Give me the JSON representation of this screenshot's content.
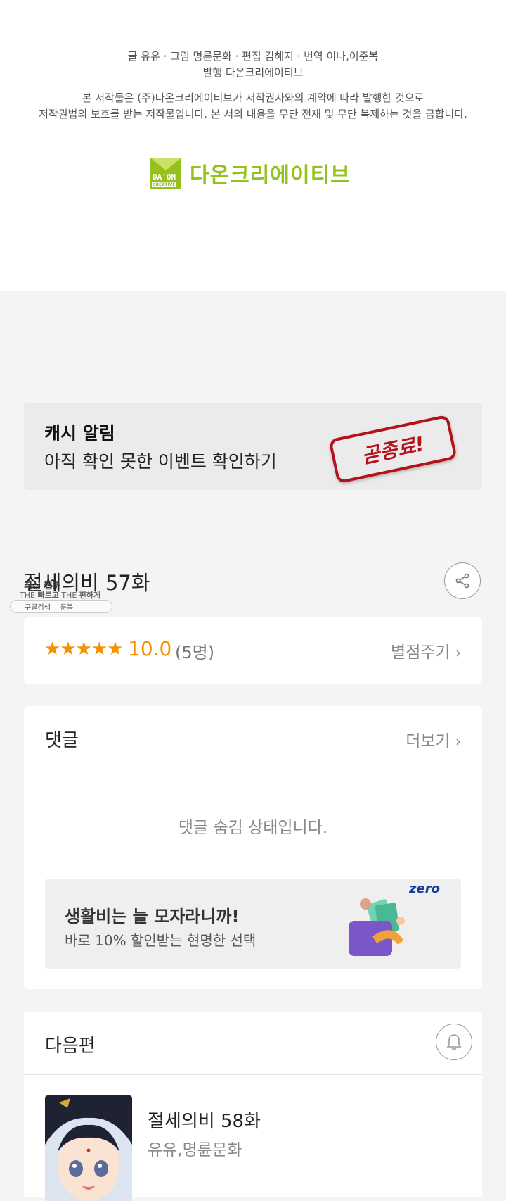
{
  "credits": {
    "line1": "글 유유 · 그림 명륜문화 · 편집 김혜지 · 번역 이나,이준복",
    "line2": "발행 다온크리에이티브",
    "line3": "본 저작물은 (주)다온크리에이티브가 저작권자와의 계약에 따라 발행한 것으로",
    "line4": "저작권법의 보호를 받는 저작물입니다. 본 서의 내용을 무단 전재 및 무단 복제하는 것을 금합니다.",
    "logo_mark_top": "DA'ON",
    "logo_mark_bottom": "CREATIVE",
    "logo_text": "다온크리에이티브"
  },
  "banner": {
    "title": "캐시 알림",
    "subtitle": "아직 확인 못한 이벤트 확인하기",
    "stamp": "곧종료!"
  },
  "episode": {
    "title": "절세의비 57화"
  },
  "watermark": {
    "line1": "최신 웹툰",
    "line2_a": "THE",
    "line2_b": "빠르고",
    "line2_c": "THE",
    "line2_d": "편하게",
    "search_label": "구글검색",
    "site_label": "툰북"
  },
  "rating": {
    "stars": "★★★★★",
    "score": "10.0",
    "count": "(5명)",
    "action": "별점주기"
  },
  "comments": {
    "heading": "댓글",
    "more": "더보기",
    "hidden_message": "댓글 숨김 상태입니다."
  },
  "ad": {
    "title": "생활비는 늘 모자라니까!",
    "subtitle": "바로 10% 할인받는 현명한 선택",
    "brand": "zero"
  },
  "next": {
    "heading": "다음편",
    "title": "절세의비 58화",
    "authors": "유유,명륜문화"
  },
  "colors": {
    "accent_green": "#95c11f",
    "rating_orange": "#f39200",
    "stamp_red": "#b3121a"
  }
}
